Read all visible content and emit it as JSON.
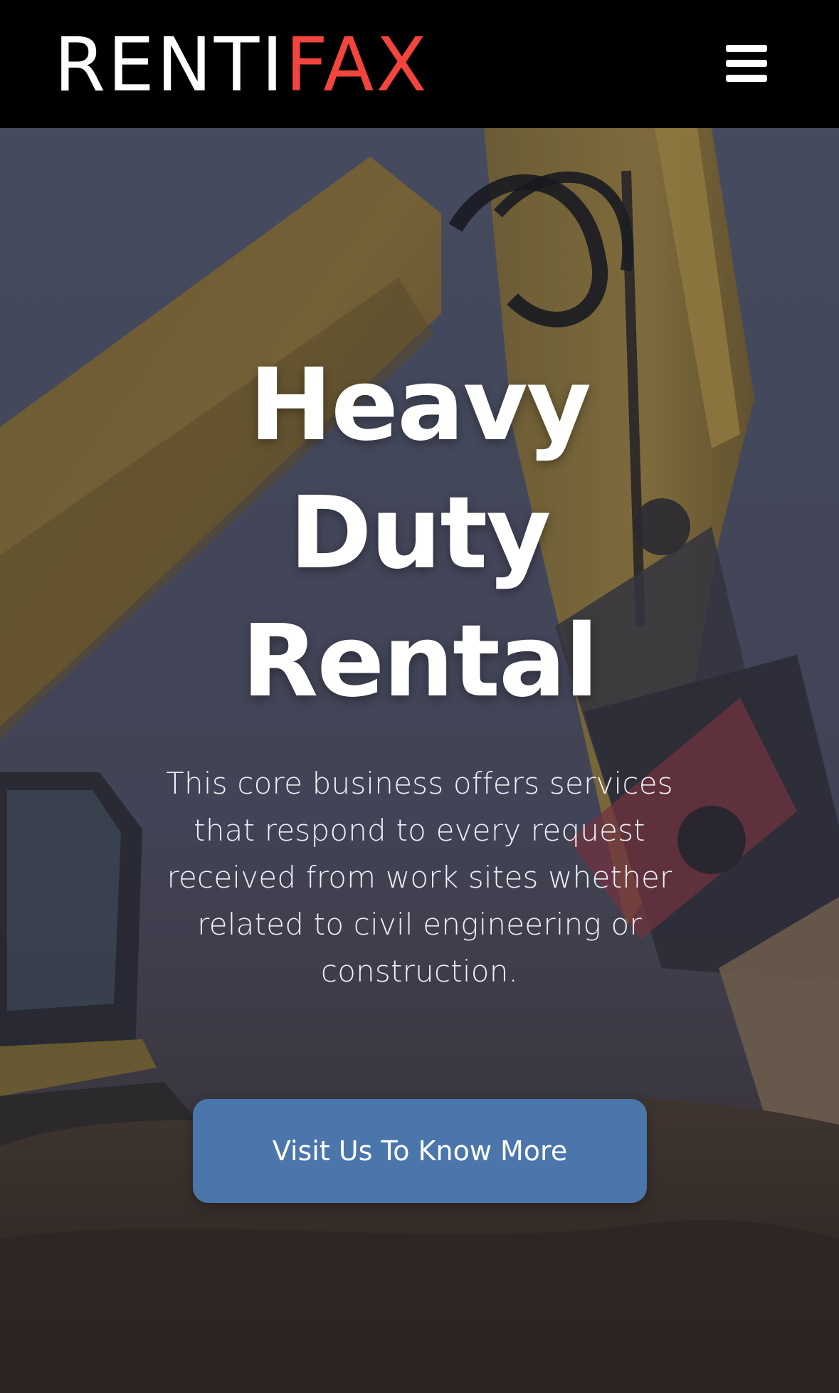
{
  "brand": {
    "logo_part_a": "RENTI",
    "logo_part_b": "FAX",
    "accent_color": "#f1453d"
  },
  "header": {
    "menu_icon": "hamburger-menu-icon"
  },
  "hero": {
    "background_image": "excavator-photo",
    "title_lines": [
      "Heavy",
      "Duty",
      "Rental"
    ],
    "description": "This core business offers services that respond to every request received from work sites whether related to civil engineering or construction.",
    "cta_label": "Visit Us To Know More",
    "cta_color": "#4a76ab"
  }
}
